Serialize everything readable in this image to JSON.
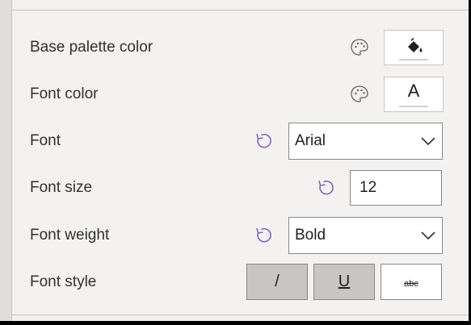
{
  "rows": {
    "base_palette": {
      "label": "Base palette color",
      "icon": "paint-bucket-icon"
    },
    "font_color": {
      "label": "Font color",
      "glyph": "A"
    },
    "font": {
      "label": "Font",
      "value": "Arial"
    },
    "font_size": {
      "label": "Font size",
      "value": "12"
    },
    "font_weight": {
      "label": "Font weight",
      "value": "Bold"
    },
    "font_style": {
      "label": "Font style",
      "italic_glyph": "/",
      "underline_glyph": "U",
      "strikethrough_glyph": "abc",
      "italic_on": true,
      "underline_on": true,
      "strikethrough_on": false
    }
  },
  "colors": {
    "accent_purple": "#8764b8",
    "panel_bg": "#f3f2f1",
    "toggle_on_bg": "#c8c6c4"
  }
}
